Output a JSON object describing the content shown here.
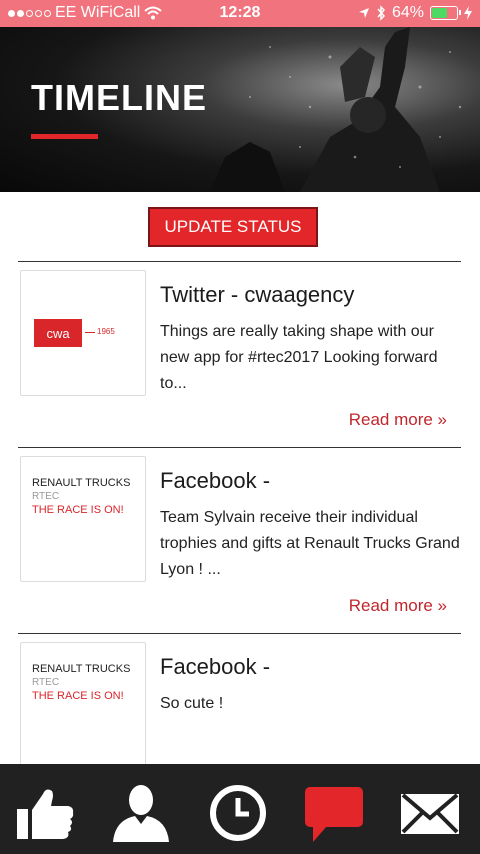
{
  "status_bar": {
    "carrier": "EE WiFiCall",
    "time": "12:28",
    "battery": "64%",
    "battery_level": 0.64,
    "icons": [
      "signal-dots-icon",
      "wifi-icon",
      "location-arrow-icon",
      "bluetooth-icon",
      "battery-icon",
      "charging-icon"
    ]
  },
  "header": {
    "title": "TIMELINE"
  },
  "update_button": {
    "label": "UPDATE STATUS"
  },
  "feed": {
    "items": [
      {
        "title": "Twitter - cwaagency",
        "text": "Things are really taking shape with our new app for #rtec2017 Looking forward to...",
        "read_more": "Read more »",
        "thumb": {
          "type": "cwa",
          "logo": "cwa",
          "suffix": "1965"
        }
      },
      {
        "title": "Facebook -",
        "text": "Team Sylvain receive their individual trophies and gifts at Renault Trucks Grand Lyon ! ...",
        "read_more": "Read more »",
        "thumb": {
          "type": "renault",
          "name": "RENAULT TRUCKS",
          "sub": "RTEC",
          "tagline": "THE RACE IS ON!"
        }
      },
      {
        "title": "Facebook -",
        "text": "So cute !",
        "read_more": "",
        "thumb": {
          "type": "renault",
          "name": "RENAULT TRUCKS",
          "sub": "RTEC",
          "tagline": "THE RACE IS ON!"
        }
      }
    ]
  },
  "bottom_nav": {
    "items": [
      {
        "icon": "thumbs-up-icon"
      },
      {
        "icon": "profile-icon"
      },
      {
        "icon": "clock-icon"
      },
      {
        "icon": "chat-icon",
        "active": true
      },
      {
        "icon": "mail-icon"
      }
    ]
  },
  "colors": {
    "status_bar": "#f0737d",
    "accent": "#e3262a",
    "nav_background": "#212121",
    "active_icon": "#e3262a"
  }
}
